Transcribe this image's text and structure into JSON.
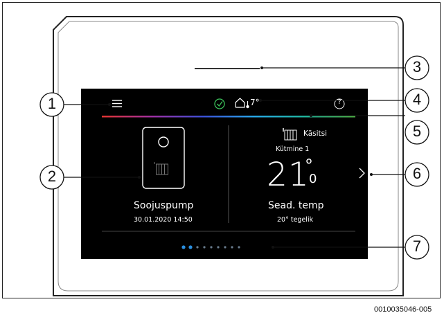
{
  "colors": {
    "screen": "#000000",
    "bezel": "#ffffff",
    "text": "#ffffff",
    "dot_active": "#2a8fe0",
    "dot_inactive": "#6a7d8e",
    "rainbow": [
      "#e3342f",
      "#9f2fa4",
      "#3a4fd6",
      "#27a7e8",
      "#1fb39b",
      "#52b847"
    ],
    "ok_icon": "#3cc35b"
  },
  "icons": {
    "menu": "menu-icon",
    "status_ok": "check-circle-icon",
    "outdoor_temp": "house-thermometer-icon",
    "help": "help-circle-icon",
    "device": "heat-pump-icon",
    "radiator": "radiator-icon",
    "next": "chevron-right-icon"
  },
  "screen": {
    "header": {
      "outdoor_temp": "7°"
    },
    "left_panel": {
      "device_name": "Soojuspump",
      "datetime": "30.01.2020 14:50"
    },
    "right_panel": {
      "mode": "Käsitsi",
      "circuit": "Kütmine 1",
      "temp_value": "21",
      "temp_degree": "°",
      "temp_decimal": "0",
      "setpoint_label": "Sead. temp",
      "setpoint_status": "20° tegelik"
    },
    "pagination": {
      "count": 9,
      "active": [
        0,
        1
      ]
    }
  },
  "callouts": [
    "1",
    "2",
    "3",
    "4",
    "5",
    "6",
    "7"
  ],
  "figure_id": "0010035046-005"
}
